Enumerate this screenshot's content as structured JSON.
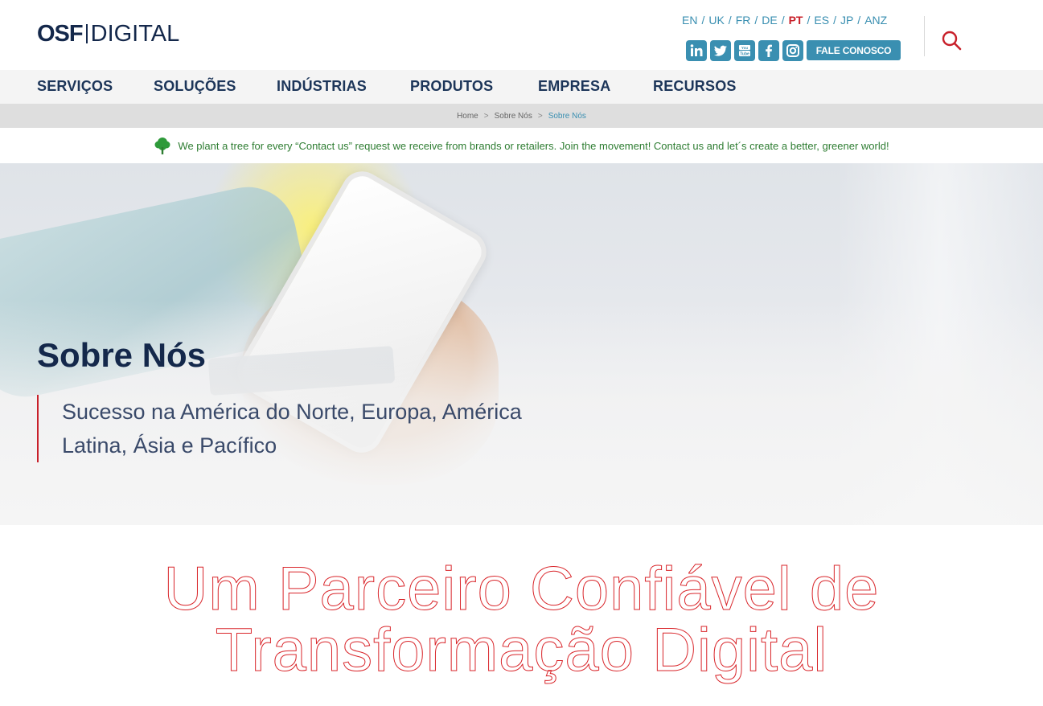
{
  "header": {
    "logo": {
      "part1": "OSF",
      "part2": "DIGITAL"
    },
    "languages": [
      "EN",
      "UK",
      "FR",
      "DE",
      "PT",
      "ES",
      "JP",
      "ANZ"
    ],
    "active_language": "PT",
    "socials": [
      "linkedin-icon",
      "twitter-icon",
      "youtube-icon",
      "facebook-icon",
      "instagram-icon"
    ],
    "cta": "FALE CONOSCO",
    "search_icon": "search-icon"
  },
  "nav": {
    "items": [
      "SERVIÇOS",
      "SOLUÇÕES",
      "INDÚSTRIAS",
      "PRODUTOS",
      "EMPRESA",
      "RECURSOS"
    ]
  },
  "breadcrumb": {
    "items": [
      "Home",
      "Sobre Nós",
      "Sobre Nós"
    ],
    "separator": ">"
  },
  "banner": {
    "icon": "tree-icon",
    "text": "We plant a tree for every “Contact us” request we receive from brands or retailers. Join the movement! Contact us and let´s create a better, greener world!"
  },
  "hero": {
    "title": "Sobre Nós",
    "subtitle": "Sucesso na América do Norte, Europa, América Latina, Ásia e Pacífico"
  },
  "main": {
    "headline": "Um Parceiro Confiável de Transformação Digital"
  },
  "colors": {
    "accent": "#3a8fb1",
    "red": "#c8202a",
    "navy": "#14284b",
    "green": "#2e7d32"
  }
}
